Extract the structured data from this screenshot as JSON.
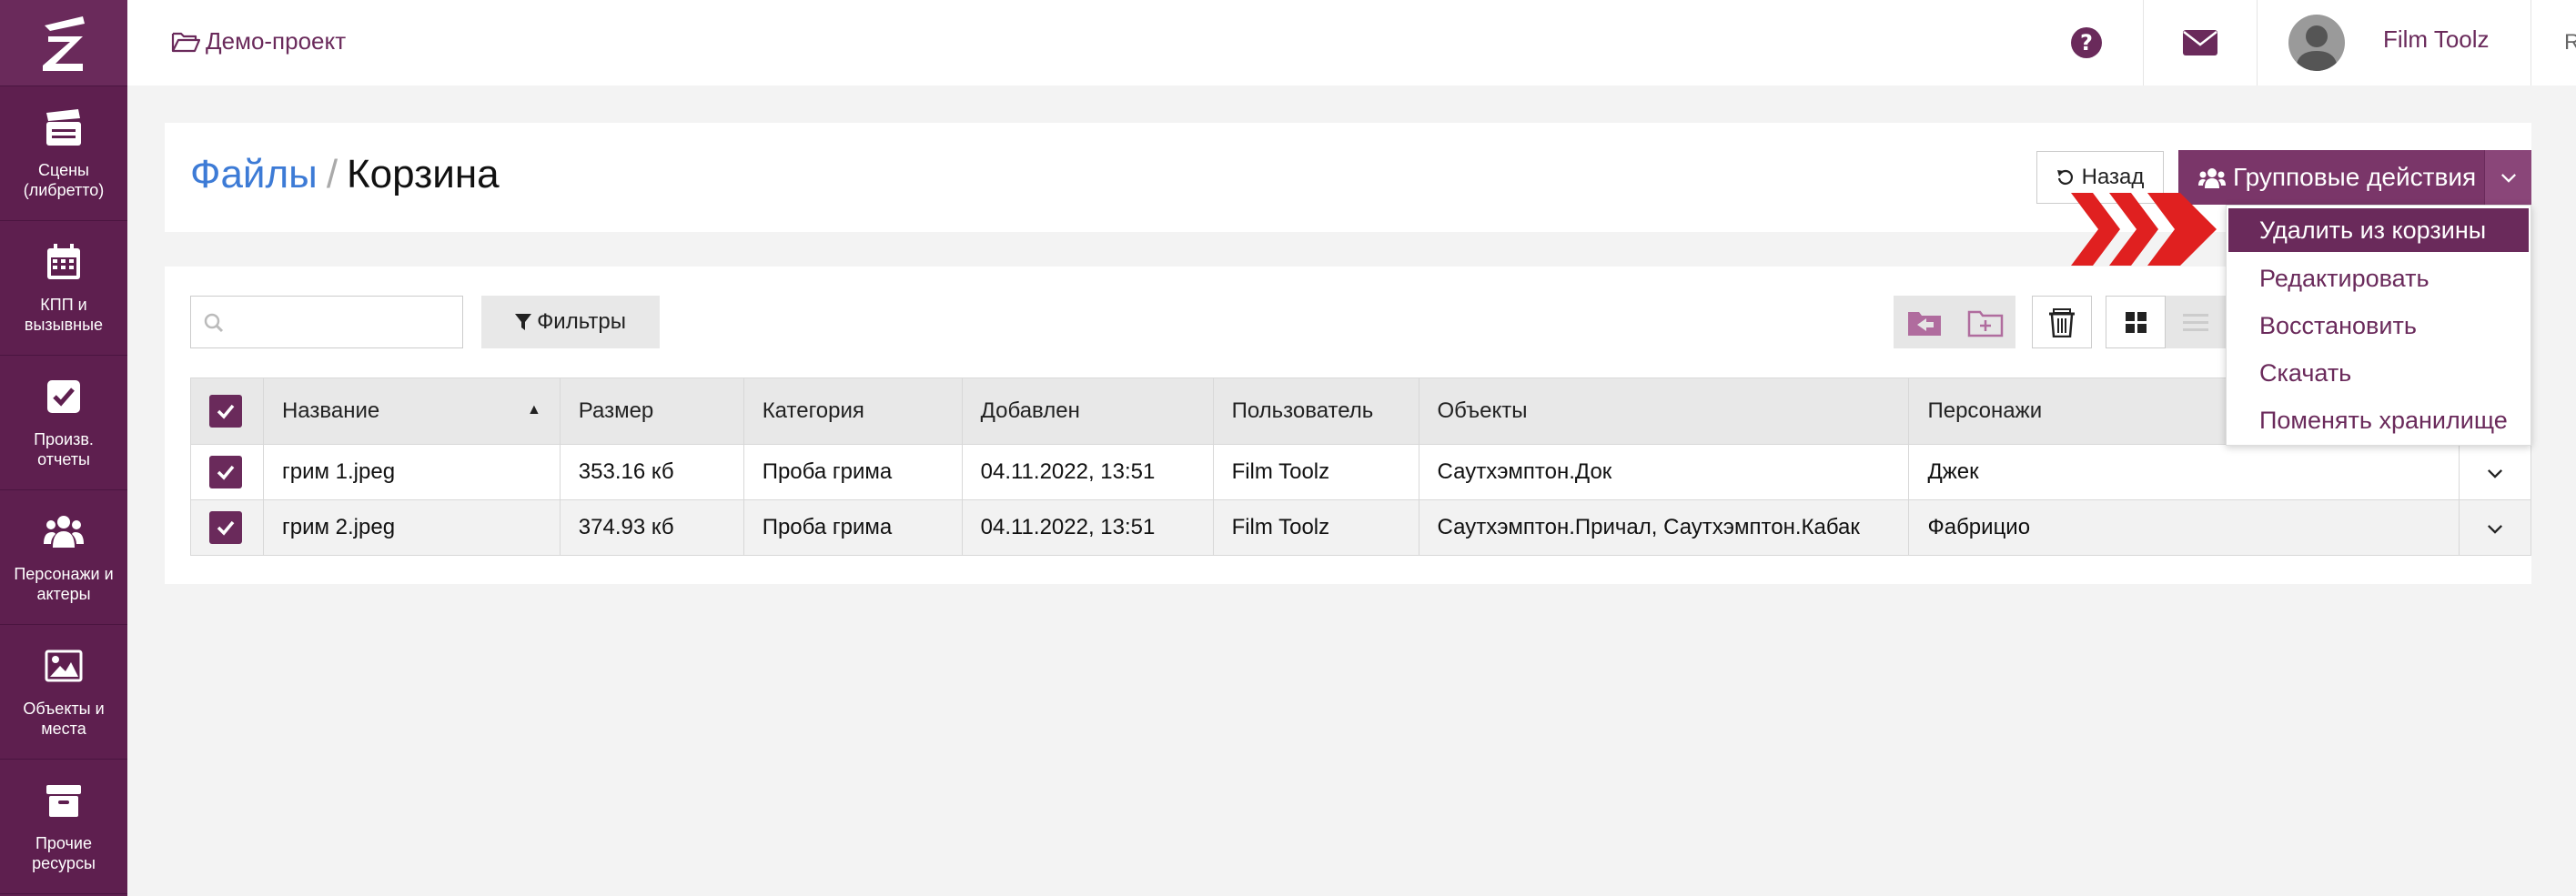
{
  "sidebar": {
    "items": [
      {
        "label": "Сцены (либретто)",
        "icon": "clapperboard-icon"
      },
      {
        "label": "КПП и вызывные",
        "icon": "calendar-icon"
      },
      {
        "label": "Произв. отчеты",
        "icon": "checkbox-icon"
      },
      {
        "label": "Персонажи и актеры",
        "icon": "users-icon"
      },
      {
        "label": "Объекты и места",
        "icon": "image-icon"
      },
      {
        "label": "Прочие ресурсы",
        "icon": "archive-icon"
      }
    ]
  },
  "topbar": {
    "project": "Демо-проект",
    "username": "Film Toolz",
    "lang": "RU"
  },
  "header": {
    "breadcrumb_link": "Файлы",
    "breadcrumb_sep": "/",
    "breadcrumb_current": "Корзина",
    "back_label": "Назад",
    "group_label": "Групповые действия"
  },
  "dropdown": {
    "items": [
      "Удалить из корзины",
      "Редактировать",
      "Восстановить",
      "Скачать",
      "Поменять хранилище"
    ]
  },
  "toolbar": {
    "search_placeholder": "",
    "filters_label": "Фильтры"
  },
  "table": {
    "headers": [
      "Название",
      "Размер",
      "Категория",
      "Добавлен",
      "Пользователь",
      "Объекты",
      "Персонажи"
    ],
    "rows": [
      [
        "грим 1.jpeg",
        "353.16 кб",
        "Проба грима",
        "04.11.2022, 13:51",
        "Film Toolz",
        "Саутхэмптон.Док",
        "Джек"
      ],
      [
        "грим 2.jpeg",
        "374.93 кб",
        "Проба грима",
        "04.11.2022, 13:51",
        "Film Toolz",
        "Саутхэмптон.Причал, Саутхэмптон.Кабак",
        "Фабрицио"
      ]
    ]
  },
  "colors": {
    "brand": "#6a2a5b",
    "sidebar": "#5e1f4f",
    "link": "#3d7bd6",
    "arrow": "#e02020"
  }
}
